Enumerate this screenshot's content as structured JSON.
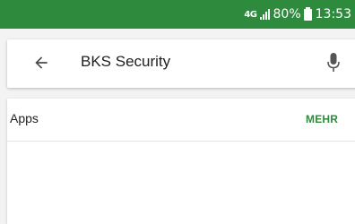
{
  "status_bar": {
    "network": "4G",
    "signal_icon": "signal-bars-icon",
    "battery_percent": "80%",
    "battery_icon": "battery-icon",
    "time": "13:53"
  },
  "search": {
    "back_icon": "arrow-left-icon",
    "query": "BKS Security",
    "mic_icon": "microphone-icon"
  },
  "apps_section": {
    "title": "Apps",
    "more_label": "MEHR"
  },
  "colors": {
    "status_bar": "#2e8b3d",
    "accent": "#2e8b3d",
    "background": "#f3f3f3"
  }
}
